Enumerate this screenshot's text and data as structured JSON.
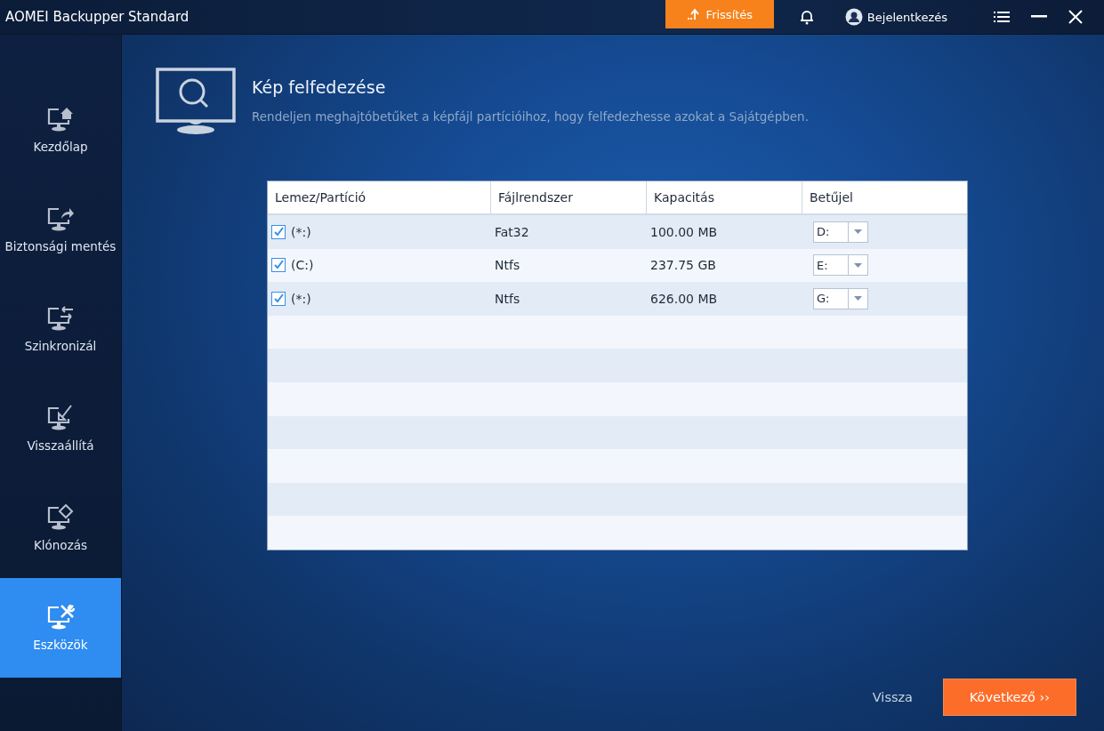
{
  "window": {
    "title": "AOMEI Backupper Standard"
  },
  "top_bar": {
    "upgrade_button": "Frissítés",
    "login": "Bejelentkezés"
  },
  "sidebar": {
    "items": [
      {
        "label": "Kezdőlap",
        "kind": "home",
        "selected": false
      },
      {
        "label": "Biztonsági mentés",
        "kind": "backup",
        "selected": false
      },
      {
        "label": "Szinkronizál",
        "kind": "sync",
        "selected": false
      },
      {
        "label": "Visszaállítá",
        "kind": "restore",
        "selected": false
      },
      {
        "label": "Klónozás",
        "kind": "clone",
        "selected": false
      },
      {
        "label": "Eszközök",
        "kind": "tools",
        "selected": true
      }
    ]
  },
  "header": {
    "title": "Kép felfedezése",
    "description": "Rendeljen meghajtóbetűket a képfájl partícióihoz, hogy felfedezhesse azokat a Sajátgépben."
  },
  "table": {
    "columns": [
      "Lemez/Partíció",
      "Fájlrendszer",
      "Kapacitás",
      "Betűjel"
    ],
    "rows": [
      {
        "partition": "(*:)",
        "checked": true,
        "filesystem": "Fat32",
        "capacity": "100.00 MB",
        "letter": "D:"
      },
      {
        "partition": "(C:)",
        "checked": true,
        "filesystem": "Ntfs",
        "capacity": "237.75 GB",
        "letter": "E:"
      },
      {
        "partition": "(*:)",
        "checked": true,
        "filesystem": "Ntfs",
        "capacity": "626.00 MB",
        "letter": "G:"
      }
    ]
  },
  "buttons": {
    "back": "Vissza",
    "next": "Következő ››"
  }
}
